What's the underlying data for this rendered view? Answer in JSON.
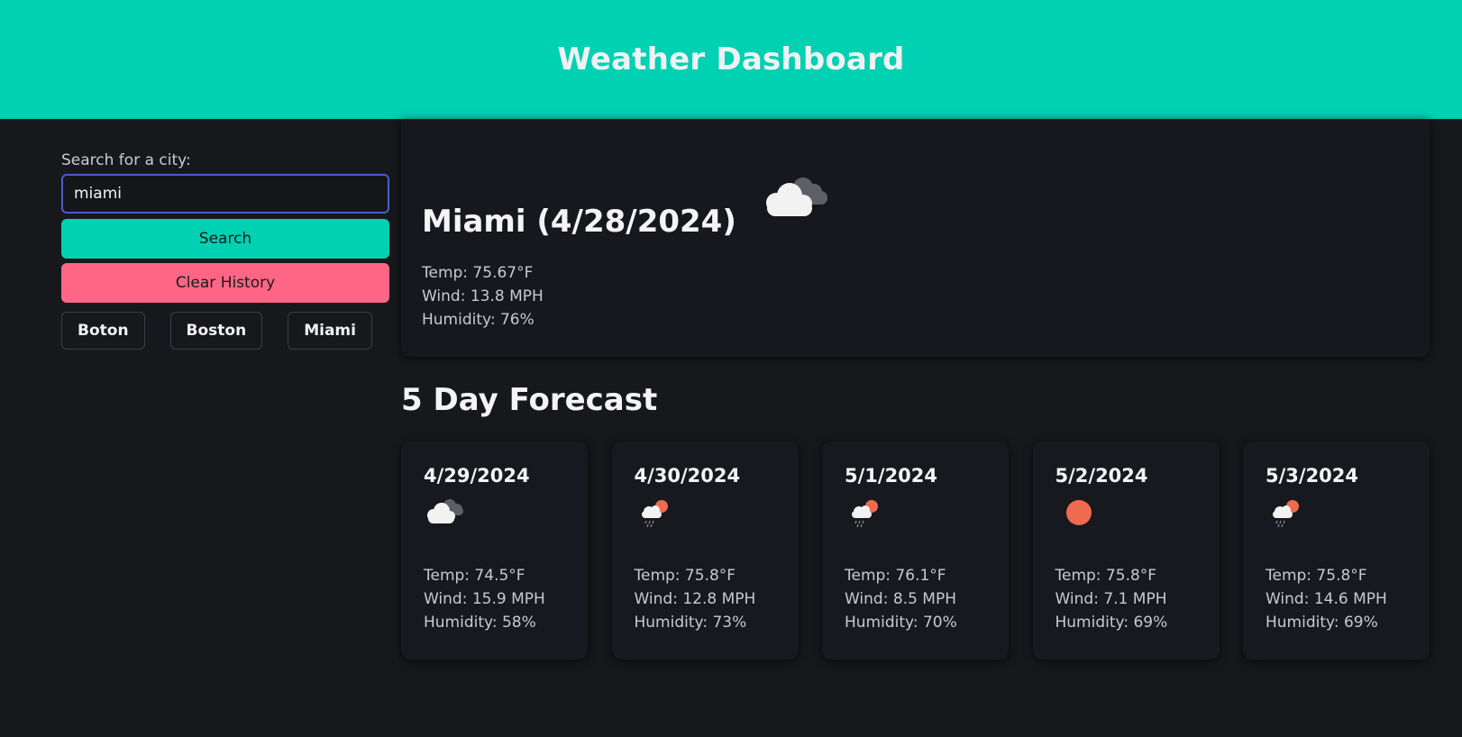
{
  "header": {
    "title": "Weather Dashboard"
  },
  "sidebar": {
    "search_label": "Search for a city:",
    "search_value": "miami",
    "search_button": "Search",
    "clear_button": "Clear History",
    "history": [
      "Boton",
      "Boston",
      "Miami"
    ]
  },
  "current": {
    "title": "Miami (4/28/2024)",
    "icon": "cloudy-icon",
    "temp": "Temp: 75.67°F",
    "wind": "Wind: 13.8 MPH",
    "humidity": "Humidity: 76%"
  },
  "forecast": {
    "heading": "5 Day Forecast",
    "days": [
      {
        "date": "4/29/2024",
        "icon": "cloudy-icon",
        "temp": "Temp: 74.5°F",
        "wind": "Wind: 15.9 MPH",
        "humidity": "Humidity: 58%"
      },
      {
        "date": "4/30/2024",
        "icon": "rain-sun-icon",
        "temp": "Temp: 75.8°F",
        "wind": "Wind: 12.8 MPH",
        "humidity": "Humidity: 73%"
      },
      {
        "date": "5/1/2024",
        "icon": "rain-sun-icon",
        "temp": "Temp: 76.1°F",
        "wind": "Wind: 8.5 MPH",
        "humidity": "Humidity: 70%"
      },
      {
        "date": "5/2/2024",
        "icon": "sun-icon",
        "temp": "Temp: 75.8°F",
        "wind": "Wind: 7.1 MPH",
        "humidity": "Humidity: 69%"
      },
      {
        "date": "5/3/2024",
        "icon": "rain-sun-icon",
        "temp": "Temp: 75.8°F",
        "wind": "Wind: 14.6 MPH",
        "humidity": "Humidity: 69%"
      }
    ]
  },
  "colors": {
    "accent": "#00d1b2",
    "danger": "#ff6685",
    "background": "#17181c",
    "sun": "#ef6a4f"
  }
}
